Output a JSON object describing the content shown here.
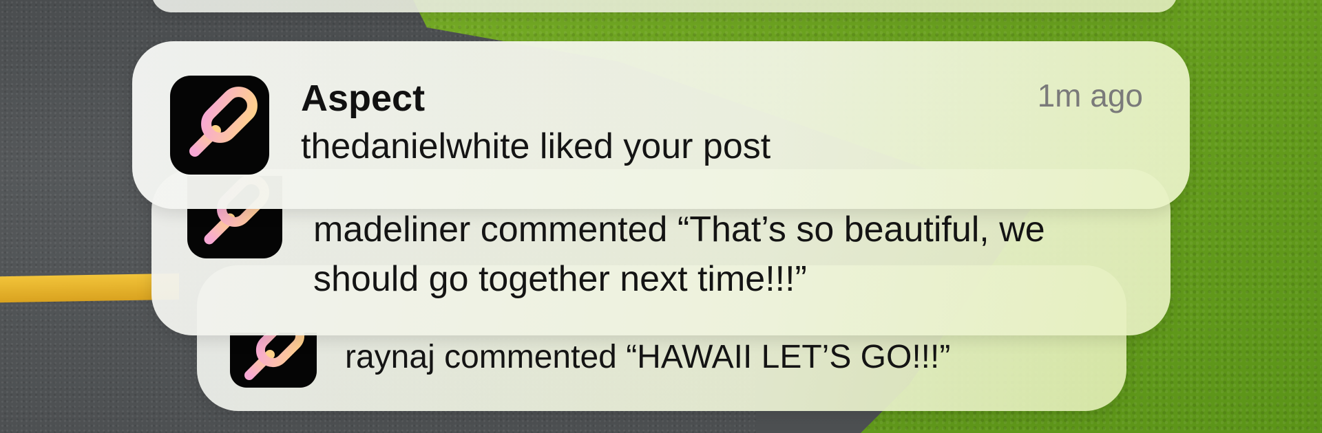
{
  "notifications": [
    {
      "app": "Aspect",
      "time": "1m ago",
      "message": "thedanielwhite liked your post",
      "icon": "aspect-app-icon"
    },
    {
      "message": "madeliner commented “That’s so beautiful, we should go together next time!!!”",
      "icon": "aspect-app-icon"
    },
    {
      "message": "raynaj commented “HAWAII LET’S GO!!!”",
      "icon": "aspect-app-icon"
    }
  ],
  "colors": {
    "icon_background": "#050505",
    "logo_gradient_start": "#f7a8d4",
    "logo_gradient_end": "#ffd18a"
  }
}
